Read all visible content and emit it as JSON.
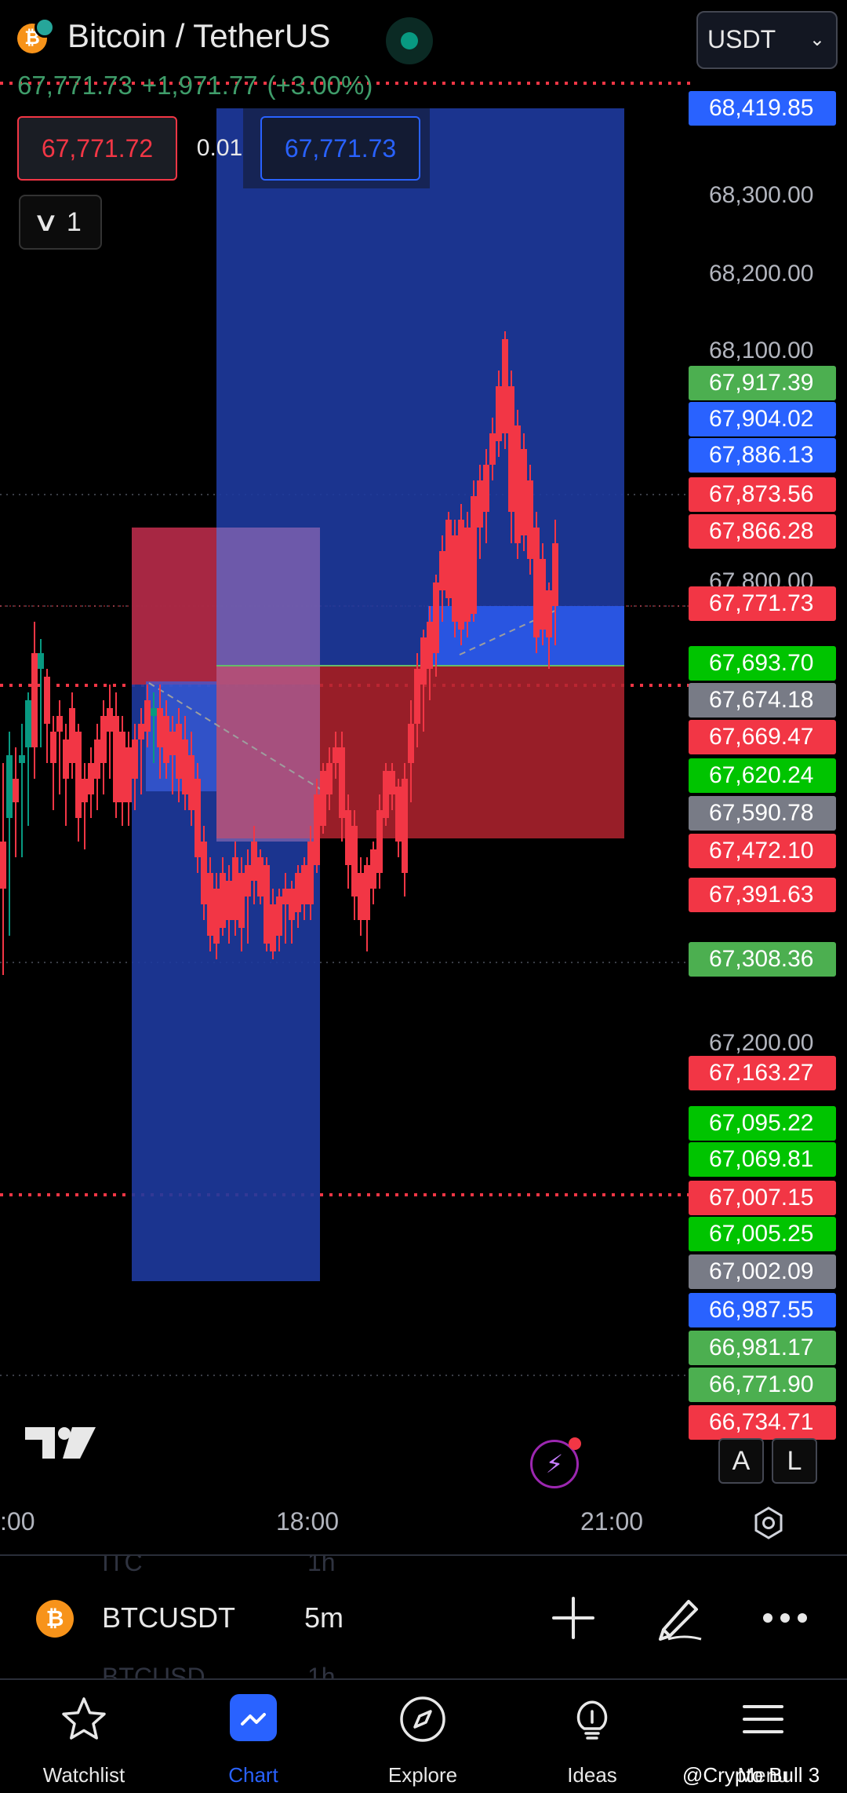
{
  "header": {
    "title": "Bitcoin / TetherUS",
    "coin_glyph": "₿",
    "currency_select": "USDT",
    "last_price": "67,771.73",
    "change_abs": "+1,971.77",
    "change_pct": "(+3.00%)"
  },
  "trade_panel": {
    "sell_price": "67,771.72",
    "quantity": "0.01",
    "buy_price": "67,771.73"
  },
  "layers_button": {
    "count": "1"
  },
  "price_axis": {
    "ticks": [
      "68,300.00",
      "68,200.00",
      "68,100.00",
      "67,800.00",
      "67,200.00"
    ],
    "labels": [
      {
        "text": "68,419.85",
        "color": "#2962ff"
      },
      {
        "text": "67,917.39",
        "color": "#4caf50"
      },
      {
        "text": "67,904.02",
        "color": "#2962ff"
      },
      {
        "text": "67,886.13",
        "color": "#2962ff"
      },
      {
        "text": "67,873.56",
        "color": "#f23645"
      },
      {
        "text": "67,866.28",
        "color": "#f23645"
      },
      {
        "text": "67,771.73",
        "color": "#f23645"
      },
      {
        "text": "67,693.70",
        "color": "#00c400"
      },
      {
        "text": "67,674.18",
        "color": "#787b86"
      },
      {
        "text": "67,669.47",
        "color": "#f23645"
      },
      {
        "text": "67,620.24",
        "color": "#00c400"
      },
      {
        "text": "67,590.78",
        "color": "#787b86"
      },
      {
        "text": "67,472.10",
        "color": "#f23645"
      },
      {
        "text": "67,391.63",
        "color": "#f23645"
      },
      {
        "text": "67,308.36",
        "color": "#4caf50"
      },
      {
        "text": "67,163.27",
        "color": "#f23645"
      },
      {
        "text": "67,095.22",
        "color": "#00c400"
      },
      {
        "text": "67,069.81",
        "color": "#00c400"
      },
      {
        "text": "67,007.15",
        "color": "#f23645"
      },
      {
        "text": "67,005.25",
        "color": "#00c400"
      },
      {
        "text": "67,002.09",
        "color": "#787b86"
      },
      {
        "text": "66,987.55",
        "color": "#2962ff"
      },
      {
        "text": "66,981.17",
        "color": "#4caf50"
      },
      {
        "text": "66,771.90",
        "color": "#4caf50"
      },
      {
        "text": "66,734.71",
        "color": "#f23645"
      }
    ]
  },
  "time_axis": {
    "labels": [
      ":00",
      "18:00",
      "21:00"
    ]
  },
  "chart_controls": {
    "auto": "A",
    "log": "L"
  },
  "symbol_bar": {
    "symbol": "BTCUSDT",
    "timeframe": "5m",
    "prev_symbol": "ITC",
    "prev_timeframe": "1h",
    "next_symbol": "BTCUSD",
    "next_timeframe": "1h"
  },
  "nav": {
    "watchlist": "Watchlist",
    "chart": "Chart",
    "explore": "Explore",
    "ideas": "Ideas",
    "menu": "Menu"
  },
  "watermark": "@Crypto Bull 3",
  "colors": {
    "up": "#089981",
    "down": "#f23645",
    "accent": "#2962ff"
  }
}
